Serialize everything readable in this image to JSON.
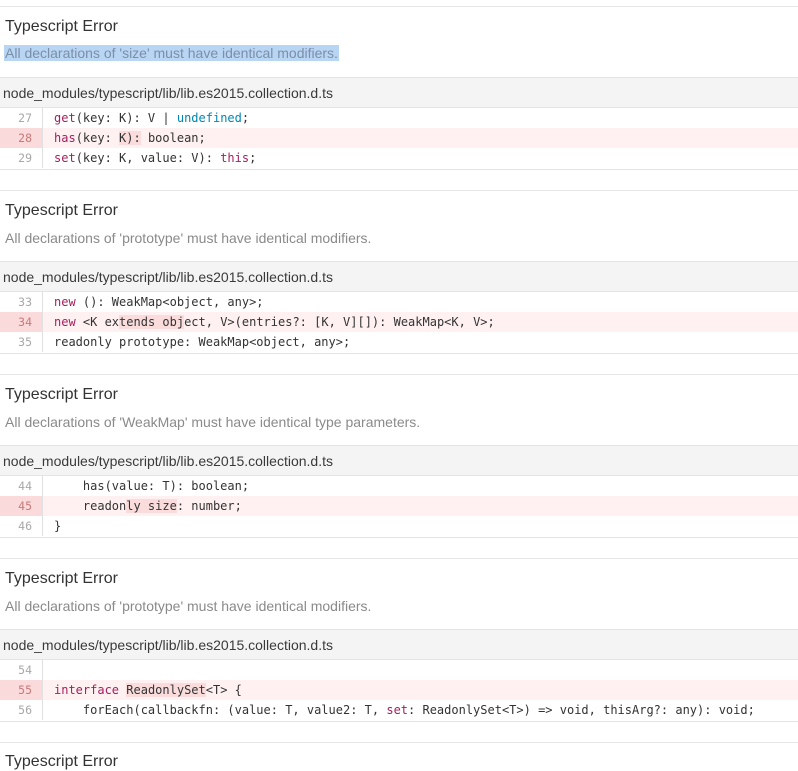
{
  "errors": [
    {
      "title": "Typescript Error",
      "message": "All declarations of 'size' must have identical modifiers.",
      "file": "node_modules/typescript/lib/lib.es2015.collection.d.ts",
      "lines": [
        {
          "num": "27",
          "text": "get(key: K): V | undefined;",
          "highlighted": false
        },
        {
          "num": "28",
          "text": "has(key: K): boolean;",
          "highlighted": true
        },
        {
          "num": "29",
          "text": "set(key: K, value: V): this;",
          "highlighted": false
        }
      ]
    },
    {
      "title": "Typescript Error",
      "message": "All declarations of 'prototype' must have identical modifiers.",
      "file": "node_modules/typescript/lib/lib.es2015.collection.d.ts",
      "lines": [
        {
          "num": "33",
          "text": "new (): WeakMap<object, any>;",
          "highlighted": false
        },
        {
          "num": "34",
          "text": "new <K extends object, V>(entries?: [K, V][]): WeakMap<K, V>;",
          "highlighted": true
        },
        {
          "num": "35",
          "text": "readonly prototype: WeakMap<object, any>;",
          "highlighted": false
        }
      ]
    },
    {
      "title": "Typescript Error",
      "message": "All declarations of 'WeakMap' must have identical type parameters.",
      "file": "node_modules/typescript/lib/lib.es2015.collection.d.ts",
      "lines": [
        {
          "num": "44",
          "text": "    has(value: T): boolean;",
          "highlighted": false
        },
        {
          "num": "45",
          "text": "    readonly size: number;",
          "highlighted": true
        },
        {
          "num": "46",
          "text": "}",
          "highlighted": false
        }
      ]
    },
    {
      "title": "Typescript Error",
      "message": "All declarations of 'prototype' must have identical modifiers.",
      "file": "node_modules/typescript/lib/lib.es2015.collection.d.ts",
      "lines": [
        {
          "num": "54",
          "text": "",
          "highlighted": false
        },
        {
          "num": "55",
          "text": "interface ReadonlySet<T> {",
          "highlighted": true
        },
        {
          "num": "56",
          "text": "    forEach(callbackfn: (value: T, value2: T, set: ReadonlySet<T>) => void, thisArg?: any): void;",
          "highlighted": false
        }
      ]
    },
    {
      "title": "Typescript Error"
    }
  ],
  "colors": {
    "selection": "#b8d5f3",
    "highlight_row": "#fff1f1",
    "highlight_gutter": "#fadada",
    "keyword": "#a71d5d",
    "builtin": "#0086b3"
  }
}
